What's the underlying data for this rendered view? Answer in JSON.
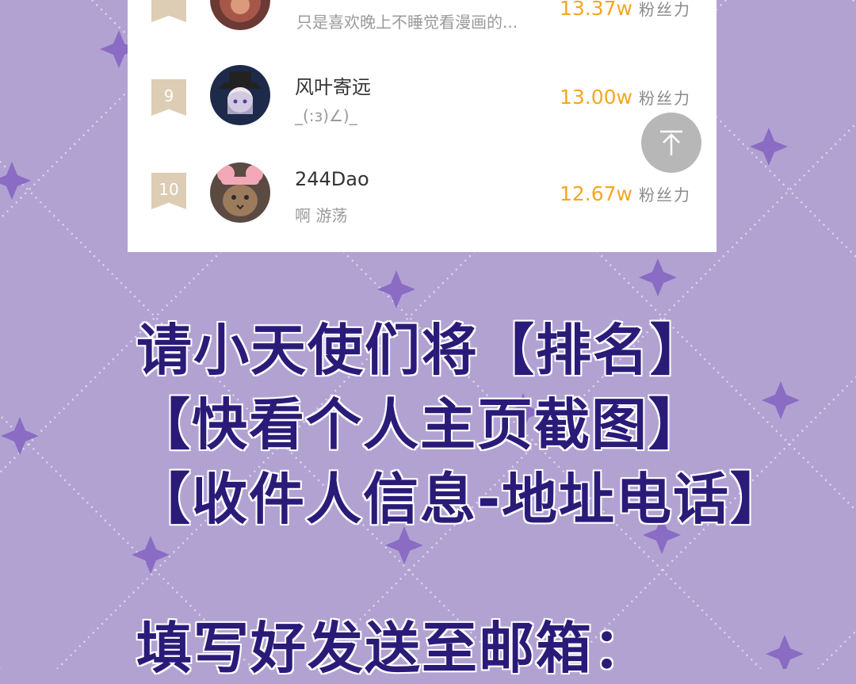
{
  "ranking": {
    "partial_row": {
      "bio": "只是喜欢晚上不睡觉看漫画的...",
      "fans_value": "13.37w",
      "fans_unit": "粉丝力"
    },
    "rows": [
      {
        "rank": "9",
        "name": "风叶寄远",
        "bio": "_(:з)∠)_",
        "fans_value": "13.00w",
        "fans_unit": "粉丝力"
      },
      {
        "rank": "10",
        "name": "244Dao",
        "bio": "啊 游荡",
        "fans_value": "12.67w",
        "fans_unit": "粉丝力"
      }
    ],
    "back_to_top_icon": "arrow-up-to-top-icon"
  },
  "notice": {
    "lines": [
      "请小天使们将【排名】",
      "【快看个人主页截图】",
      "【收件人信息-地址电话】",
      "填写好发送至邮箱："
    ]
  },
  "colors": {
    "background": "#b2a2d2",
    "accent_fans": "#f5a623",
    "notice_text": "#2b1b78",
    "rank_badge": "#dccdb4"
  }
}
